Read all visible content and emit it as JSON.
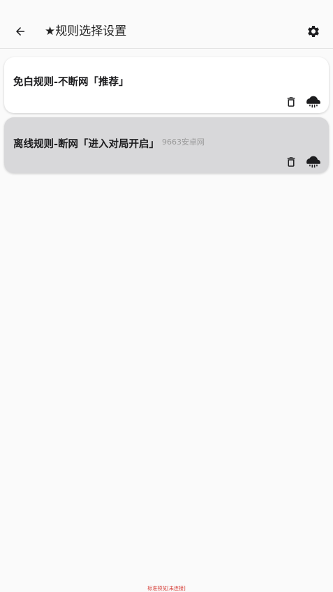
{
  "appbar": {
    "title": "★规则选择设置",
    "back_icon": "arrow-left-icon",
    "settings_icon": "gear-icon"
  },
  "rules": [
    {
      "title": "免白规则-不断网「推荐」",
      "selected": false
    },
    {
      "title": "离线规则-断网「进入对局开启」",
      "selected": true,
      "watermark": "9663安卓网"
    }
  ],
  "card_icons": {
    "delete": "trash-icon",
    "download": "cloud-download-icon"
  },
  "footer": {
    "note": "标准预览[未连接]"
  },
  "colors": {
    "background": "#fafafa",
    "card": "#ffffff",
    "selected_card": "#d8d8da",
    "footer_text": "#d4332c"
  }
}
